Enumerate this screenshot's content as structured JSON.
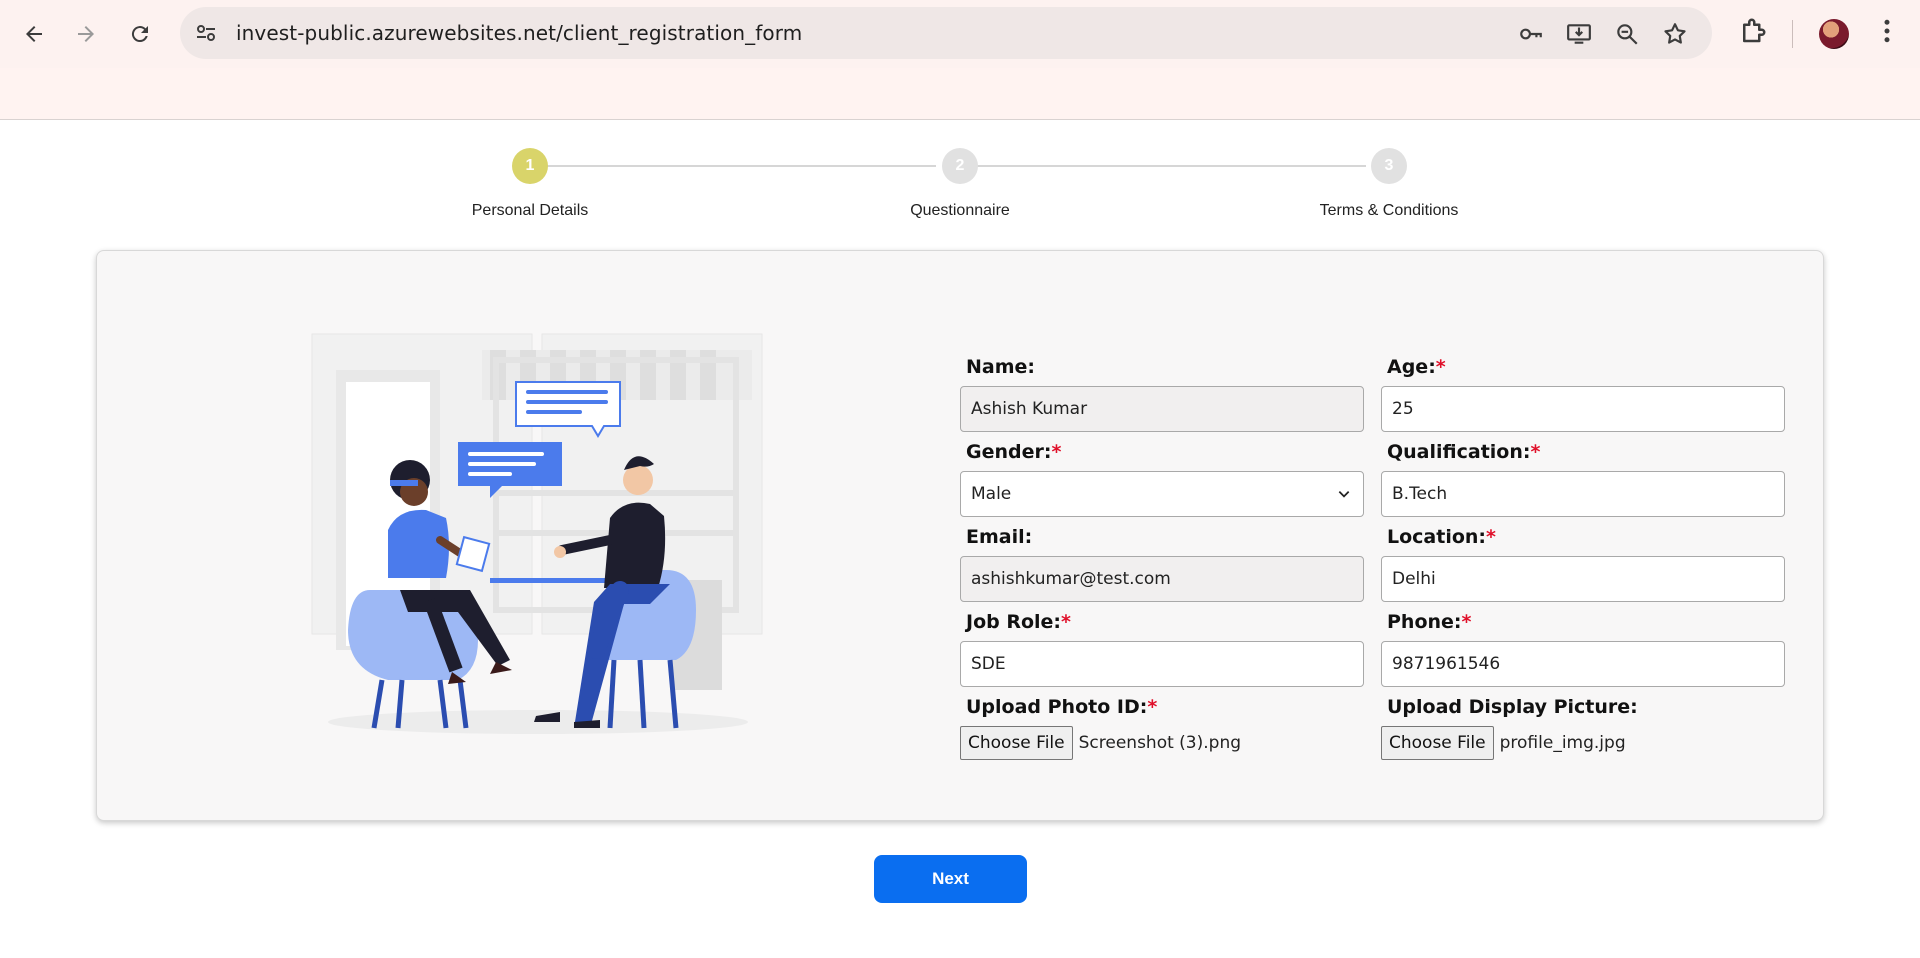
{
  "browser": {
    "url": "invest-public.azurewebsites.net/client_registration_form"
  },
  "stepper": {
    "steps": [
      {
        "number": "1",
        "label": "Personal Details",
        "active": true
      },
      {
        "number": "2",
        "label": "Questionnaire",
        "active": false
      },
      {
        "number": "3",
        "label": "Terms & Conditions",
        "active": false
      }
    ]
  },
  "form": {
    "name": {
      "label": "Name:",
      "value": "Ashish Kumar"
    },
    "age": {
      "label": "Age:",
      "required": "*",
      "value": "25"
    },
    "gender": {
      "label": "Gender:",
      "required": "*",
      "value": "Male"
    },
    "qualification": {
      "label": "Qualification:",
      "required": "*",
      "value": "B.Tech"
    },
    "email": {
      "label": "Email:",
      "value": "ashishkumar@test.com"
    },
    "location": {
      "label": "Location:",
      "required": "*",
      "value": "Delhi"
    },
    "job_role": {
      "label": "Job Role:",
      "required": "*",
      "value": "SDE"
    },
    "phone": {
      "label": "Phone:",
      "required": "*",
      "value": "9871961546"
    },
    "photo_id": {
      "label": "Upload Photo ID:",
      "required": "*",
      "button": "Choose File",
      "file": "Screenshot (3).png"
    },
    "display_picture": {
      "label": "Upload Display Picture:",
      "button": "Choose File",
      "file": "profile_img.jpg"
    }
  },
  "actions": {
    "next_label": "Next"
  },
  "colors": {
    "accent": "#0a6ef0",
    "active_step": "#d9d46a",
    "required": "#e0102a",
    "illustration_blue": "#4b7bec"
  }
}
